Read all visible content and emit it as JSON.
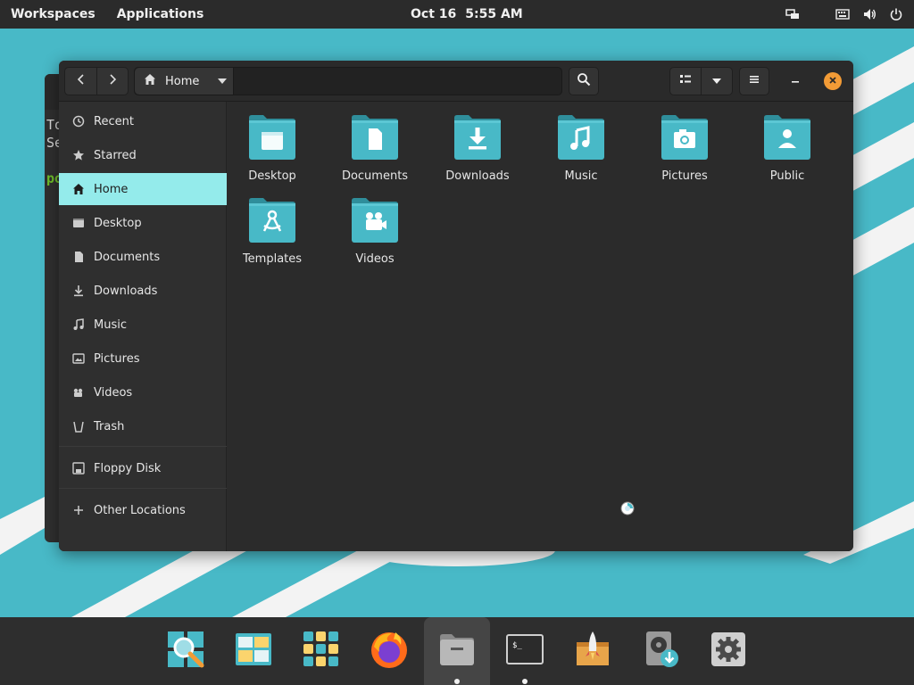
{
  "topbar": {
    "workspaces_label": "Workspaces",
    "applications_label": "Applications",
    "date": "Oct 16",
    "time": "5:55 AM"
  },
  "background_window": {
    "line1": "To",
    "line2": "Se",
    "line3": "po"
  },
  "window": {
    "path_label": "Home",
    "sidebar": [
      {
        "label": "Recent",
        "icon": "clock-icon"
      },
      {
        "label": "Starred",
        "icon": "star-icon"
      },
      {
        "label": "Home",
        "icon": "home-icon",
        "active": true
      },
      {
        "label": "Desktop",
        "icon": "desktop-icon"
      },
      {
        "label": "Documents",
        "icon": "document-icon"
      },
      {
        "label": "Downloads",
        "icon": "download-icon"
      },
      {
        "label": "Music",
        "icon": "music-icon"
      },
      {
        "label": "Pictures",
        "icon": "picture-icon"
      },
      {
        "label": "Videos",
        "icon": "video-icon"
      },
      {
        "label": "Trash",
        "icon": "trash-icon"
      },
      {
        "label": "Floppy Disk",
        "icon": "floppy-icon"
      },
      {
        "label": "Other Locations",
        "icon": "plus-icon"
      }
    ],
    "files": [
      {
        "label": "Desktop",
        "icon": "desktop-folder-icon"
      },
      {
        "label": "Documents",
        "icon": "documents-folder-icon"
      },
      {
        "label": "Downloads",
        "icon": "downloads-folder-icon"
      },
      {
        "label": "Music",
        "icon": "music-folder-icon"
      },
      {
        "label": "Pictures",
        "icon": "pictures-folder-icon"
      },
      {
        "label": "Public",
        "icon": "public-folder-icon"
      },
      {
        "label": "Templates",
        "icon": "templates-folder-icon"
      },
      {
        "label": "Videos",
        "icon": "videos-folder-icon"
      }
    ]
  },
  "dock": [
    {
      "name": "search-app-icon",
      "running": false
    },
    {
      "name": "workspaces-app-icon",
      "running": false
    },
    {
      "name": "app-grid-icon",
      "running": false
    },
    {
      "name": "firefox-icon",
      "running": false
    },
    {
      "name": "files-app-icon",
      "running": true,
      "active": true
    },
    {
      "name": "terminal-app-icon",
      "running": true
    },
    {
      "name": "pop-shop-icon",
      "running": false
    },
    {
      "name": "installer-app-icon",
      "running": false
    },
    {
      "name": "settings-app-icon",
      "running": false
    }
  ],
  "colors": {
    "accent": "#94ebeb",
    "folder": "#48b9c7",
    "close": "#f29b36",
    "wallpaper": "#48b9c7"
  }
}
